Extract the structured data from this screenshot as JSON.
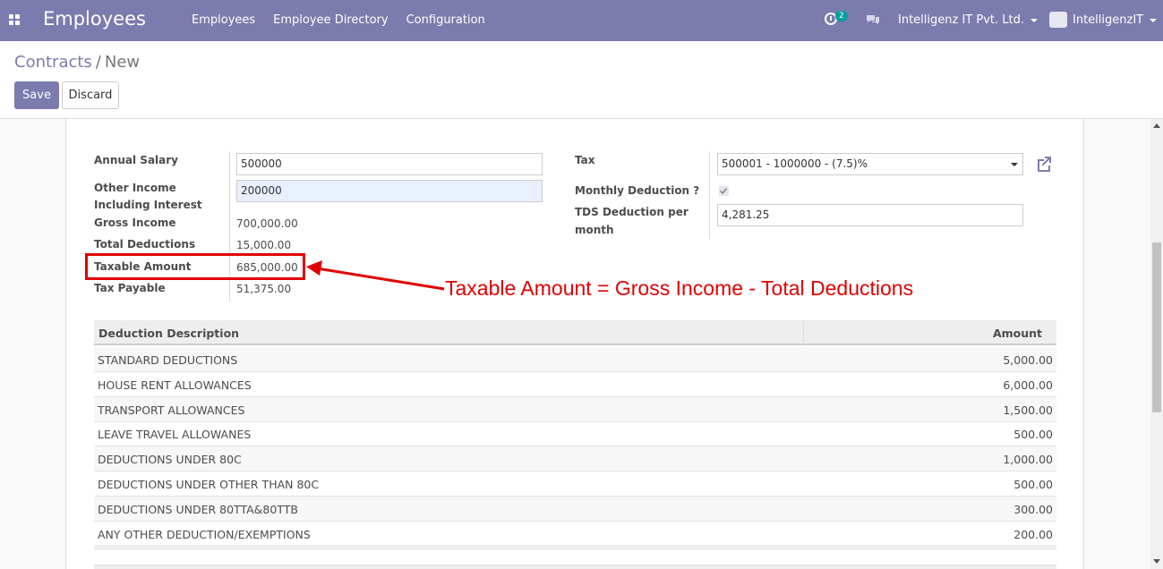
{
  "navbar": {
    "app_title": "Employees",
    "menu": [
      "Employees",
      "Employee Directory",
      "Configuration"
    ],
    "activity_count": "2",
    "company": "Intelligenz IT Pvt. Ltd.",
    "user": "IntelligenzIT"
  },
  "breadcrumb": {
    "parent": "Contracts",
    "separator": "/",
    "current": "New"
  },
  "buttons": {
    "save": "Save",
    "discard": "Discard"
  },
  "left_fields": {
    "annual_salary_label": "Annual Salary",
    "annual_salary_value": "500000",
    "other_income_label_1": "Other Income",
    "other_income_label_2": "Including Interest",
    "other_income_value": "200000",
    "gross_income_label": "Gross Income",
    "gross_income_value": "700,000.00",
    "total_deductions_label": "Total Deductions",
    "total_deductions_value": "15,000.00",
    "taxable_amount_label": "Taxable Amount",
    "taxable_amount_value": "685,000.00",
    "tax_payable_label": "Tax Payable",
    "tax_payable_value": "51,375.00"
  },
  "right_fields": {
    "tax_label": "Tax",
    "tax_value": "500001 - 1000000 - (7.5)%",
    "monthly_deduction_label": "Monthly Deduction ?",
    "monthly_deduction_checked": true,
    "tds_label_1": "TDS Deduction per",
    "tds_label_2": "month",
    "tds_value": "4,281.25"
  },
  "annotation": "Taxable Amount = Gross Income - Total Deductions",
  "deductions_table": {
    "headers": [
      "Deduction Description",
      "Amount"
    ],
    "rows": [
      [
        "STANDARD DEDUCTIONS",
        "5,000.00"
      ],
      [
        "HOUSE RENT ALLOWANCES",
        "6,000.00"
      ],
      [
        "TRANSPORT ALLOWANCES",
        "1,500.00"
      ],
      [
        "LEAVE TRAVEL ALLOWANES",
        "500.00"
      ],
      [
        "DEDUCTIONS UNDER 80C",
        "1,000.00"
      ],
      [
        "DEDUCTIONS UNDER OTHER THAN 80C",
        "500.00"
      ],
      [
        "DEDUCTIONS UNDER 80TTA&80TTB",
        "300.00"
      ],
      [
        "ANY OTHER DEDUCTION/EXEMPTIONS",
        "200.00"
      ]
    ]
  },
  "colors": {
    "brand": "#7c7bad",
    "annotation": "#e00000",
    "highlight_input": "#e8f0fe"
  }
}
